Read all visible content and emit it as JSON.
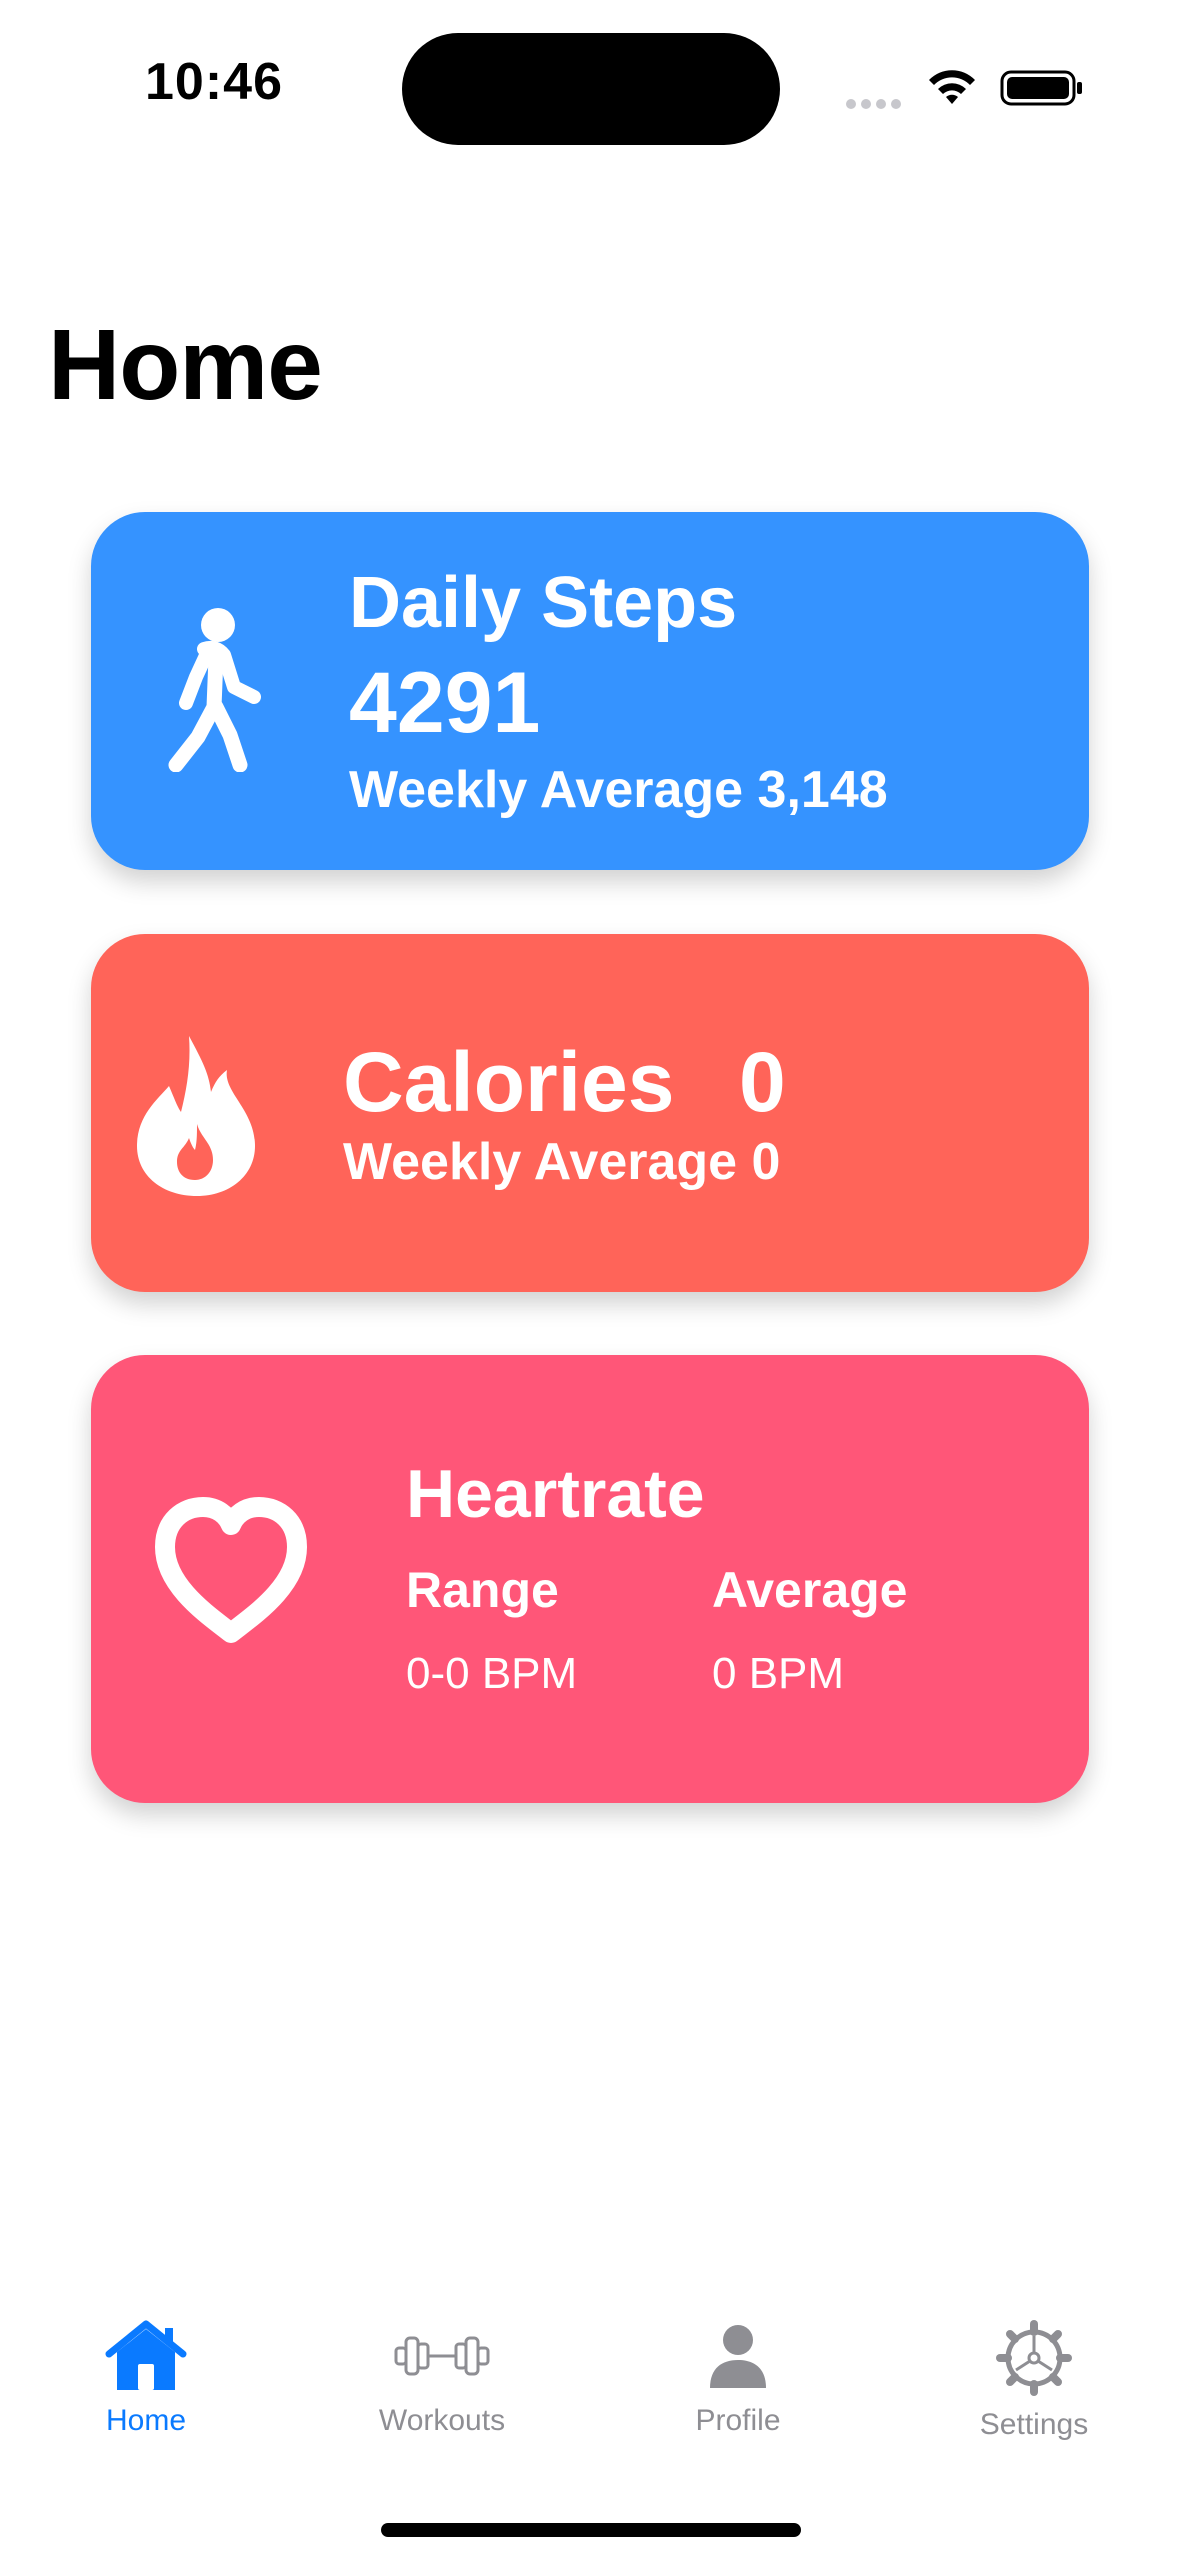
{
  "status_bar": {
    "time": "10:46"
  },
  "page": {
    "title": "Home"
  },
  "cards": {
    "steps": {
      "title": "Daily Steps",
      "value": "4291",
      "weekly_average": "Weekly Average 3,148",
      "color": "#3593ff",
      "icon": "walking-figure-icon"
    },
    "calories": {
      "title": "Calories",
      "value": "0",
      "weekly_average": "Weekly Average 0",
      "color": "#ff6459",
      "icon": "flame-icon"
    },
    "heartrate": {
      "title": "Heartrate",
      "range_label": "Range",
      "range_value": "0-0 BPM",
      "average_label": "Average",
      "average_value": "0 BPM",
      "color": "#ff5678",
      "icon": "heart-icon"
    }
  },
  "tab_bar": {
    "tabs": [
      {
        "label": "Home",
        "icon": "house-icon",
        "selected": true
      },
      {
        "label": "Workouts",
        "icon": "dumbbell-icon",
        "selected": false
      },
      {
        "label": "Profile",
        "icon": "person-icon",
        "selected": false
      },
      {
        "label": "Settings",
        "icon": "gear-icon",
        "selected": false
      }
    ],
    "active_color": "#0a7aff",
    "inactive_color": "#8e8e93"
  }
}
